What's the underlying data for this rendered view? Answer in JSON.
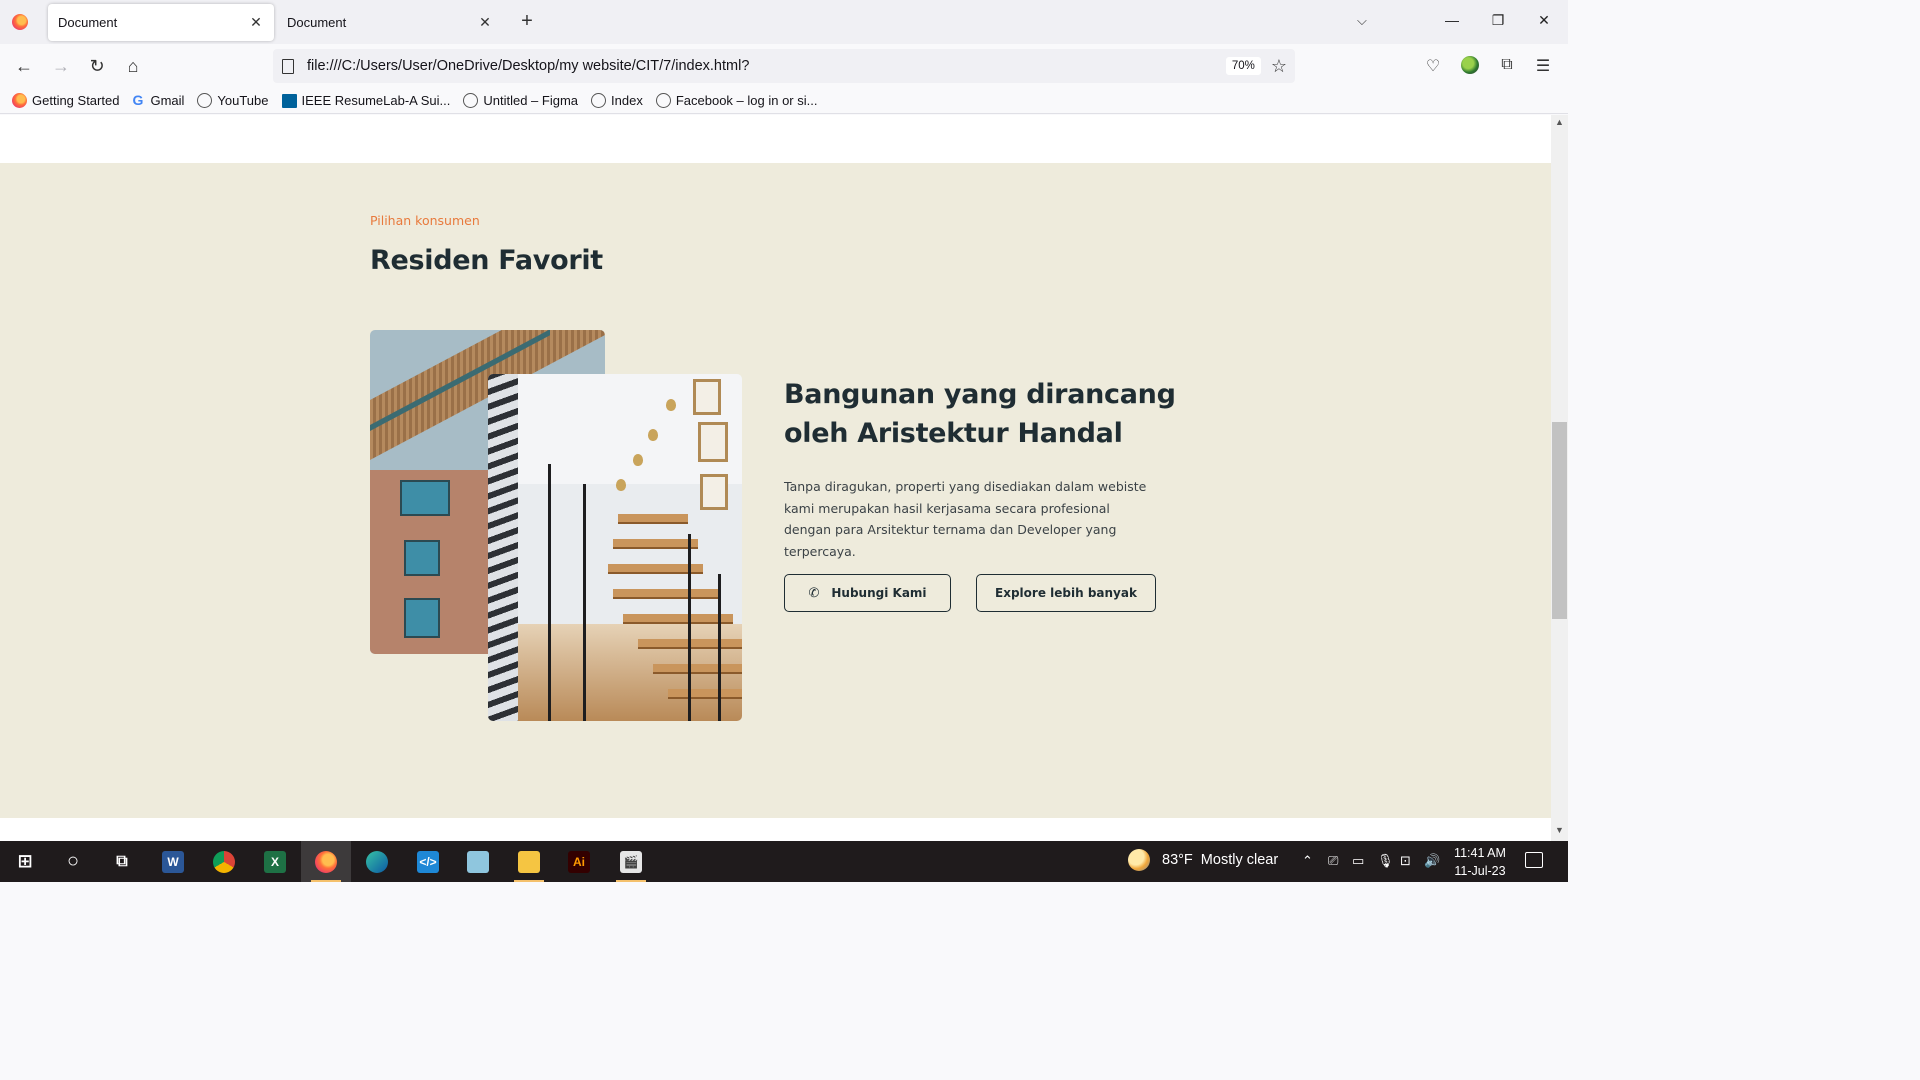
{
  "browser": {
    "tabs": [
      {
        "title": "Document",
        "active": true
      },
      {
        "title": "Document",
        "active": false
      }
    ],
    "url": "file:///C:/Users/User/OneDrive/Desktop/my website/CIT/7/index.html?",
    "zoom": "70%",
    "bookmarks": [
      {
        "label": "Getting Started",
        "icon": "firefox-icon"
      },
      {
        "label": "Gmail",
        "icon": "google-icon"
      },
      {
        "label": "YouTube",
        "icon": "globe-icon"
      },
      {
        "label": "IEEE ResumeLab-A Sui...",
        "icon": "ieee-icon"
      },
      {
        "label": "Untitled – Figma",
        "icon": "globe-icon"
      },
      {
        "label": "Index",
        "icon": "globe-icon"
      },
      {
        "label": "Facebook – log in or si...",
        "icon": "globe-icon"
      }
    ]
  },
  "page": {
    "eyebrow": "Pilihan konsumen",
    "title": "Residen Favorit",
    "feature_title": "Bangunan yang dirancang oleh Aristektur Handal",
    "feature_desc": "Tanpa diragukan, properti yang disediakan dalam webiste kami merupakan hasil kerjasama secara profesional dengan para Arsitektur ternama dan Developer yang terpercaya.",
    "contact_button": "Hubungi Kami",
    "explore_button": "Explore lebih banyak",
    "colors": {
      "section_bg": "#eeebdc",
      "accent": "#e87a3d",
      "heading": "#1f2d33"
    }
  },
  "taskbar": {
    "apps": [
      "start",
      "search",
      "task-view",
      "word",
      "chrome",
      "excel",
      "firefox",
      "edge",
      "vscode",
      "notepad",
      "file-explorer",
      "illustrator",
      "video-editor"
    ],
    "weather_temp": "83°F",
    "weather_text": "Mostly clear",
    "time": "11:41 AM",
    "date": "11-Jul-23"
  }
}
